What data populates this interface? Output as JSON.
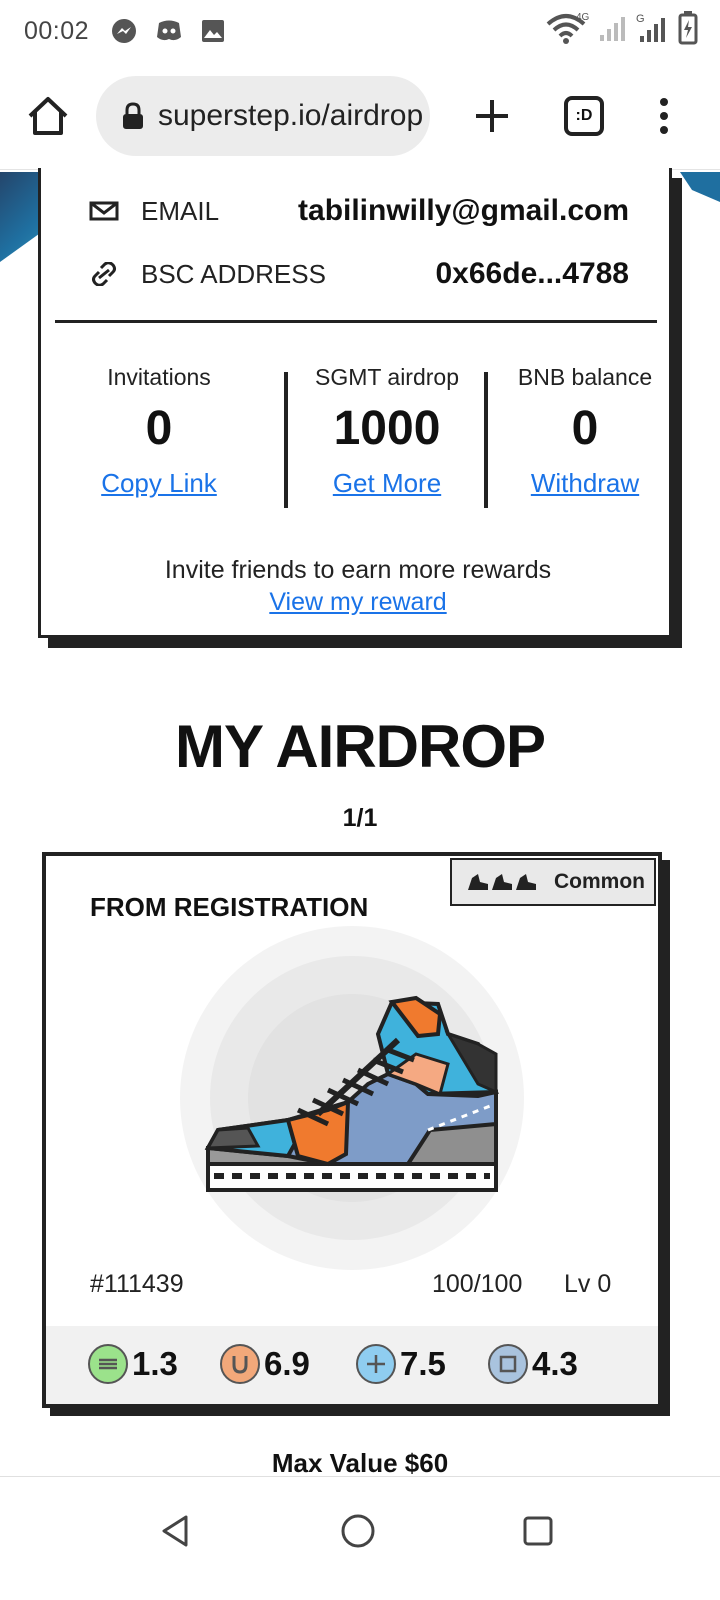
{
  "status_bar": {
    "time": "00:02",
    "network_4g": "4G",
    "network_g": "G"
  },
  "browser": {
    "url": "superstep.io/airdrop",
    "tab_count": ":D"
  },
  "account": {
    "email_label": "EMAIL",
    "email_value": "tabilinwilly@gmail.com",
    "bsc_label": "BSC ADDRESS",
    "bsc_value": "0x66de...4788",
    "stats": [
      {
        "title": "Invitations",
        "value": "0",
        "link": "Copy Link"
      },
      {
        "title": "SGMT airdrop",
        "value": "1000",
        "link": "Get More"
      },
      {
        "title": "BNB balance",
        "value": "0",
        "link": "Withdraw"
      }
    ],
    "invite_text": "Invite friends to earn more rewards",
    "view_reward": "View my reward"
  },
  "airdrop": {
    "title": "MY AIRDROP",
    "count": "1/1",
    "card": {
      "rarity": "Common",
      "source": "FROM REGISTRATION",
      "token_id": "#111439",
      "durability": "100/100",
      "level": "Lv 0",
      "attributes": [
        {
          "icon": "efficiency-icon",
          "value": "1.3",
          "color": "#9be28b"
        },
        {
          "icon": "luck-icon",
          "value": "6.9",
          "color": "#f2a87a"
        },
        {
          "icon": "comfort-icon",
          "value": "7.5",
          "color": "#8fcdf0"
        },
        {
          "icon": "resilience-icon",
          "value": "4.3",
          "color": "#a9c3de"
        }
      ]
    },
    "max_value": "Max Value $60"
  },
  "colors": {
    "link": "#1a73e8",
    "border": "#222222"
  }
}
